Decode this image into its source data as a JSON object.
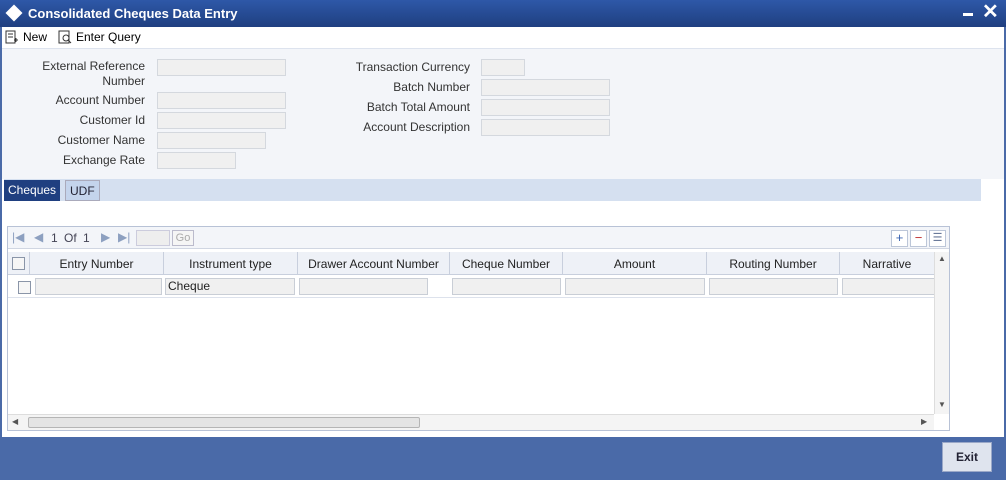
{
  "window": {
    "title": "Consolidated Cheques Data Entry"
  },
  "toolbar": {
    "new_label": "New",
    "enter_query_label": "Enter Query"
  },
  "form": {
    "external_reference_label": "External Reference Number",
    "account_number_label": "Account Number",
    "customer_id_label": "Customer Id",
    "customer_name_label": "Customer Name",
    "exchange_rate_label": "Exchange Rate",
    "transaction_currency_label": "Transaction Currency",
    "batch_number_label": "Batch Number",
    "batch_total_amount_label": "Batch Total Amount",
    "account_description_label": "Account Description"
  },
  "tabs": [
    {
      "label": "Cheques",
      "active": true
    },
    {
      "label": "UDF",
      "active": false
    }
  ],
  "grid": {
    "pager": {
      "page": "1",
      "of_label": "Of",
      "total": "1",
      "go_label": "Go"
    },
    "columns": [
      "Entry Number",
      "Instrument type",
      "Drawer Account Number",
      "Cheque Number",
      "Amount",
      "Routing Number",
      "Narrative"
    ],
    "rows": [
      {
        "entry_number": "",
        "instrument_type": "Cheque",
        "drawer_account_number": "",
        "cheque_number": "",
        "amount": "",
        "routing_number": "",
        "narrative": ""
      }
    ]
  },
  "footer": {
    "exit_label": "Exit"
  },
  "colors": {
    "title_bar": "#2e58a8",
    "tab_active": "#1f3f80",
    "frame": "#4a6aa8"
  }
}
